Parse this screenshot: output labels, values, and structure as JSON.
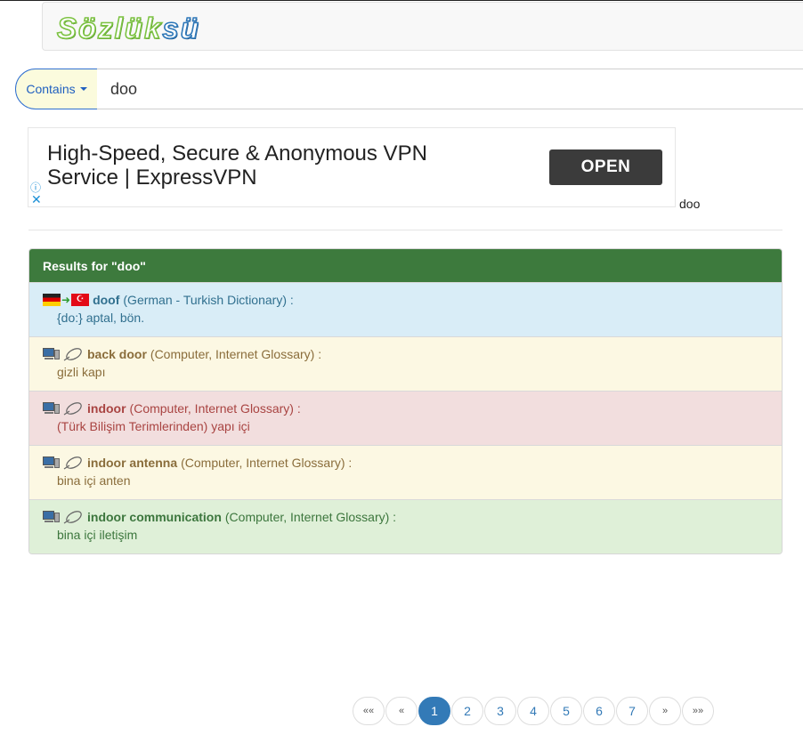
{
  "header": {
    "logo_part1": "Sözlük",
    "logo_part2": "sü"
  },
  "search": {
    "mode_label": "Contains",
    "query": "doo"
  },
  "ad": {
    "headline_line1": "High-Speed, Secure & Anonymous VPN",
    "headline_line2": "Service | ExpressVPN",
    "cta": "OPEN",
    "info_glyph": "ⓘ",
    "close_glyph": "✕"
  },
  "side_term": "doo",
  "results": {
    "title": "Results for \"doo\"",
    "items": [
      {
        "term": "doof",
        "source": "(German - Turkish Dictionary) :",
        "meaning": "{do:} aptal, bön.",
        "style": "info",
        "icon": "de-tr-flags-icon"
      },
      {
        "term": "back door",
        "source": "(Computer, Internet Glossary) :",
        "meaning": "gizli kapı",
        "style": "warn",
        "icon": "computer-glossary-icon"
      },
      {
        "term": "indoor",
        "source": "(Computer, Internet Glossary) :",
        "meaning": "(Türk Bilişim Terimlerinden) yapı içi",
        "style": "danger",
        "icon": "computer-glossary-icon"
      },
      {
        "term": "indoor antenna",
        "source": "(Computer, Internet Glossary) :",
        "meaning": "bina içi anten",
        "style": "warn",
        "icon": "computer-glossary-icon"
      },
      {
        "term": "indoor communication",
        "source": "(Computer, Internet Glossary) :",
        "meaning": "bina içi iletişim",
        "style": "success",
        "icon": "computer-glossary-icon"
      }
    ]
  },
  "pagination": {
    "first": "««",
    "prev": "«",
    "pages": [
      "1",
      "2",
      "3",
      "4",
      "5",
      "6",
      "7"
    ],
    "current": "1",
    "next": "»",
    "last": "»»"
  }
}
